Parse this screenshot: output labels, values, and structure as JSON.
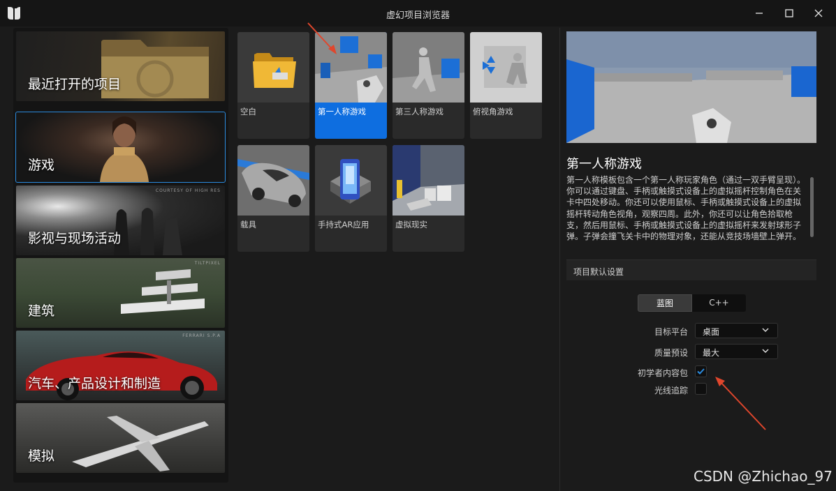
{
  "window": {
    "title": "虚幻项目浏览器",
    "controls": [
      "minimize-icon",
      "maximize-icon",
      "close-icon"
    ]
  },
  "categories": [
    {
      "label": "最近打开的项目",
      "selected": false
    },
    {
      "label": "游戏",
      "selected": true
    },
    {
      "label": "影视与现场活动",
      "selected": false,
      "credit": "COURTESY OF HIGH RES"
    },
    {
      "label": "建筑",
      "selected": false,
      "credit": "TILTPIXEL"
    },
    {
      "label": "汽车、产品设计和制造",
      "selected": false,
      "credit": "FERRARI S.P.A"
    },
    {
      "label": "模拟",
      "selected": false
    }
  ],
  "templates": [
    {
      "label": "空白",
      "selected": false
    },
    {
      "label": "第一人称游戏",
      "selected": true
    },
    {
      "label": "第三人称游戏",
      "selected": false
    },
    {
      "label": "俯视角游戏",
      "selected": false
    },
    {
      "label": "载具",
      "selected": false
    },
    {
      "label": "手持式AR应用",
      "selected": false
    },
    {
      "label": "虚拟现实",
      "selected": false
    }
  ],
  "details": {
    "title": "第一人称游戏",
    "description": "第一人称模板包含一个第一人称玩家角色（通过一双手臂呈现）。你可以通过键盘、手柄或触摸式设备上的虚拟摇杆控制角色在关卡中四处移动。你还可以使用鼠标、手柄或触摸式设备上的虚拟摇杆转动角色视角，观察四周。此外，你还可以让角色拾取枪支，然后用鼠标、手柄或触摸式设备上的虚拟摇杆来发射球形子弹。子弹会撞飞关卡中的物理对象，还能从竞技场墙壁上弹开。",
    "section_header": "项目默认设置",
    "language_options": [
      "蓝图",
      "C++"
    ],
    "language_selected": "蓝图",
    "target_platform_label": "目标平台",
    "target_platform_value": "桌面",
    "quality_label": "质量预设",
    "quality_value": "最大",
    "starter_content_label": "初学者内容包",
    "starter_content_checked": true,
    "raytracing_label": "光线追踪",
    "raytracing_checked": false
  },
  "colors": {
    "accent": "#0e6ee0",
    "annotation_arrow": "#e0462c"
  },
  "watermark": "CSDN @Zhichao_97"
}
